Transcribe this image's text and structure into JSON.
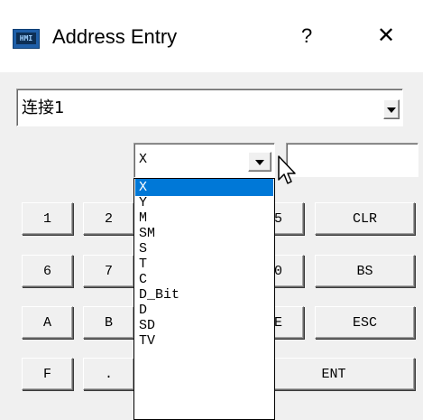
{
  "window": {
    "title": "Address Entry",
    "icon_text": "HMI",
    "help_label": "?",
    "close_label": "✕"
  },
  "connection": {
    "selected": "连接1"
  },
  "device": {
    "selected": "X",
    "address_value": ""
  },
  "keypad": {
    "keys": [
      "1",
      "2",
      "CLR",
      "6",
      "7",
      "BS",
      "A",
      "B",
      "ESC",
      "F",
      ".",
      "ENT"
    ],
    "partial_keys": [
      "5",
      "0",
      "E"
    ]
  },
  "dropdown": {
    "options": [
      "X",
      "Y",
      "M",
      "SM",
      "S",
      "T",
      "C",
      "D_Bit",
      "D",
      "SD",
      "TV"
    ],
    "selected_index": 0
  },
  "colors": {
    "selection": "#0078d7",
    "background": "#f0f0f0"
  }
}
